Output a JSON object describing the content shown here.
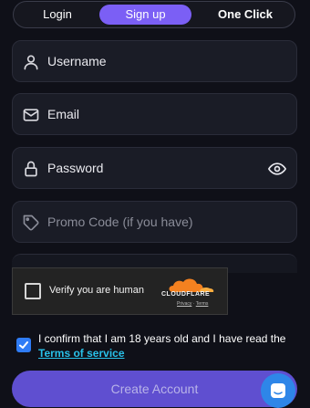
{
  "tabs": [
    {
      "label": "Login"
    },
    {
      "label": "Sign up"
    },
    {
      "label": "One Click"
    }
  ],
  "active_tab": "Sign up",
  "form": {
    "username_placeholder": "Username",
    "email_placeholder": "Email",
    "password_placeholder": "Password",
    "promo_placeholder": "Promo Code (if you have)"
  },
  "captcha": {
    "label": "Verify you are human",
    "brand": "CLOUDFLARE",
    "privacy": "Privacy",
    "separator": " · ",
    "terms": "Terms"
  },
  "confirm": {
    "checked": true,
    "text": "I confirm that I am 18 years old and I have read the",
    "terms_link": "Terms of service"
  },
  "create_button": "Create Account",
  "icons": [
    "user-icon",
    "mail-icon",
    "lock-icon",
    "eye-icon",
    "tag-icon",
    "checkmark-icon",
    "chat-icon",
    "cloudflare-logo"
  ],
  "colors": {
    "background": "#0f1018",
    "field": "#1a1c26",
    "active_tab": "#7b5ff5",
    "button": "#5f4fd0",
    "link": "#28c0e8",
    "checkbox": "#2f7cf6",
    "chat": "#2e86e8",
    "cloudflare_orange": "#f48120"
  }
}
